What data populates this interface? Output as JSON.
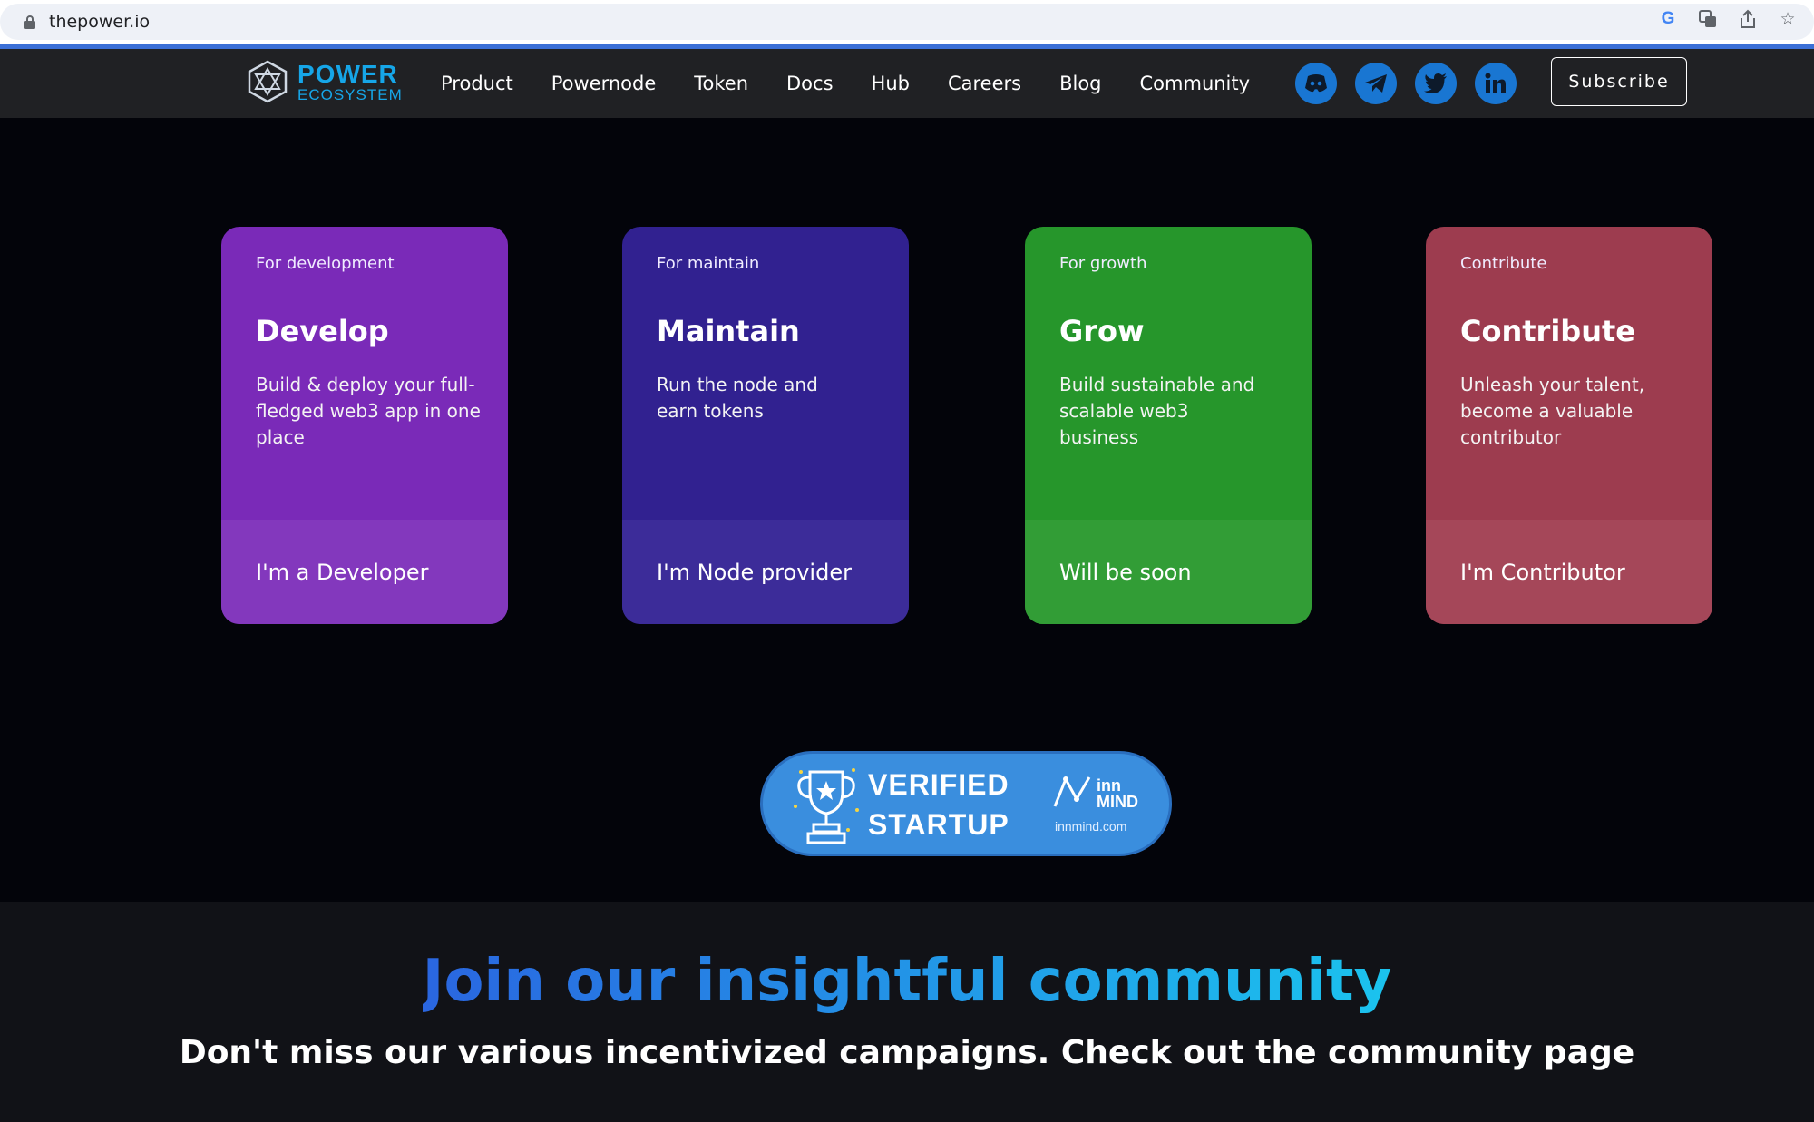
{
  "browser": {
    "url": "thepower.io"
  },
  "nav": {
    "logo": {
      "line1": "POWER",
      "line2": "ECOSYSTEM"
    },
    "items": [
      {
        "label": "Product"
      },
      {
        "label": "Powernode"
      },
      {
        "label": "Token"
      },
      {
        "label": "Docs"
      },
      {
        "label": "Hub"
      },
      {
        "label": "Careers"
      },
      {
        "label": "Blog"
      },
      {
        "label": "Community"
      }
    ],
    "socials": [
      "discord-icon",
      "telegram-icon",
      "twitter-icon",
      "linkedin-icon"
    ],
    "subscribe_label": "Subscribe"
  },
  "cards": [
    {
      "tag": "For development",
      "title": "Develop",
      "desc": "Build & deploy your full-fledged web3 app in one place",
      "action": "I'm a Developer",
      "color": "#7a2ab8"
    },
    {
      "tag": "For maintain",
      "title": "Maintain",
      "desc": "Run the node and earn tokens",
      "action": "I'm Node provider",
      "color": "#312190"
    },
    {
      "tag": "For growth",
      "title": "Grow",
      "desc": "Build sustainable and scalable web3 business",
      "action": "Will be soon",
      "color": "#26962b"
    },
    {
      "tag": "Contribute",
      "title": "Contribute",
      "desc": "Unleash your talent, become a valuable contributor",
      "action": "I'm Contributor",
      "color": "#9d3c4f"
    }
  ],
  "badge": {
    "line1": "VERIFIED",
    "line2": "STARTUP",
    "brand_line1": "inn",
    "brand_line2": "MIND",
    "brand_url": "innmind.com"
  },
  "community": {
    "title": "Join our insightful community",
    "subtitle": "Don't miss our various incentivized campaigns. Check out the community page"
  }
}
